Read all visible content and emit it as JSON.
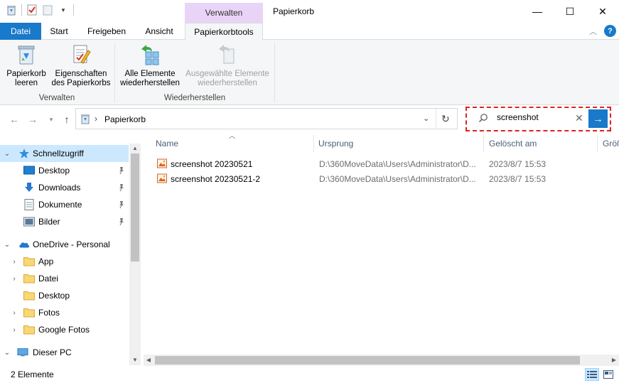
{
  "window": {
    "title": "Papierkorb",
    "context_tab_header": "Verwalten",
    "minimize_glyph": "—",
    "maximize_glyph": "☐",
    "close_glyph": "✕"
  },
  "tabs": [
    {
      "label": "Datei"
    },
    {
      "label": "Start"
    },
    {
      "label": "Freigeben"
    },
    {
      "label": "Ansicht"
    },
    {
      "label": "Papierkorbtools"
    }
  ],
  "ribbon": {
    "groups": [
      {
        "label": "Verwalten",
        "buttons": [
          {
            "line1": "Papierkorb",
            "line2": "leeren",
            "icon": "empty-recycle-bin-icon"
          },
          {
            "line1": "Eigenschaften",
            "line2": "des Papierkorbs",
            "icon": "recycle-bin-properties-icon"
          }
        ]
      },
      {
        "label": "Wiederherstellen",
        "buttons": [
          {
            "line1": "Alle Elemente",
            "line2": "wiederherstellen",
            "icon": "restore-all-icon"
          },
          {
            "line1": "Ausgewählte Elemente",
            "line2": "wiederherstellen",
            "icon": "restore-selected-icon",
            "disabled": true
          }
        ]
      }
    ]
  },
  "address": {
    "path": "Papierkorb"
  },
  "search": {
    "value": "screenshot"
  },
  "navpane": {
    "items": [
      {
        "label": "Schnellzugriff",
        "icon": "star-icon"
      },
      {
        "label": "Desktop",
        "icon": "desktop-icon"
      },
      {
        "label": "Downloads",
        "icon": "download-icon"
      },
      {
        "label": "Dokumente",
        "icon": "document-icon"
      },
      {
        "label": "Bilder",
        "icon": "pictures-icon"
      },
      {
        "label": "OneDrive - Personal",
        "icon": "cloud-icon"
      },
      {
        "label": "App",
        "icon": "folder-icon"
      },
      {
        "label": "Datei",
        "icon": "folder-icon"
      },
      {
        "label": "Desktop",
        "icon": "folder-icon"
      },
      {
        "label": "Fotos",
        "icon": "folder-icon"
      },
      {
        "label": "Google Fotos",
        "icon": "folder-icon"
      },
      {
        "label": "Dieser PC",
        "icon": "computer-icon"
      }
    ]
  },
  "list": {
    "columns": [
      "Name",
      "Ursprung",
      "Gelöscht am",
      "Größ"
    ],
    "rows": [
      {
        "name": "screenshot 20230521",
        "origin": "D:\\360MoveData\\Users\\Administrator\\D...",
        "deleted": "2023/8/7 15:53"
      },
      {
        "name": "screenshot 20230521-2",
        "origin": "D:\\360MoveData\\Users\\Administrator\\D...",
        "deleted": "2023/8/7 15:53"
      }
    ]
  },
  "status": {
    "count": "2 Elemente"
  },
  "colors": {
    "accent": "#1979ca",
    "context_tab": "#e9d4f7",
    "selection": "#cce8ff",
    "highlight_border": "#e02020"
  }
}
